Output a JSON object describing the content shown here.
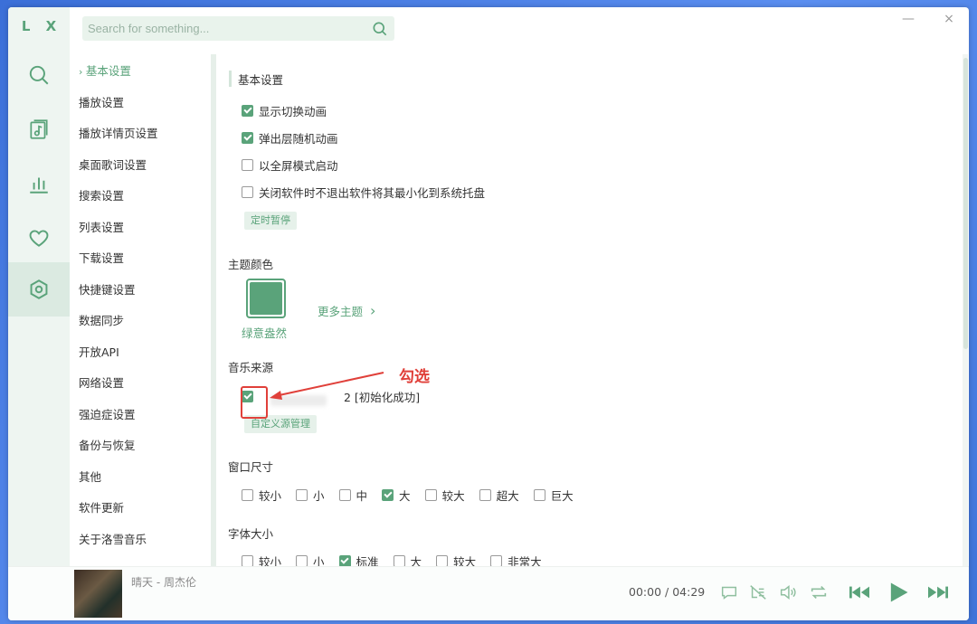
{
  "app": {
    "logo": "L X"
  },
  "search": {
    "placeholder": "Search for something..."
  },
  "window_controls": {
    "minimize": "—",
    "close": "×"
  },
  "rail": [
    {
      "name": "search-icon"
    },
    {
      "name": "music-list-icon"
    },
    {
      "name": "chart-icon"
    },
    {
      "name": "heart-icon"
    },
    {
      "name": "settings-icon",
      "active": true
    }
  ],
  "nav": {
    "items": [
      {
        "label": "基本设置",
        "active": true
      },
      {
        "label": "播放设置"
      },
      {
        "label": "播放详情页设置"
      },
      {
        "label": "桌面歌词设置"
      },
      {
        "label": "搜索设置"
      },
      {
        "label": "列表设置"
      },
      {
        "label": "下载设置"
      },
      {
        "label": "快捷键设置"
      },
      {
        "label": "数据同步"
      },
      {
        "label": "开放API"
      },
      {
        "label": "网络设置"
      },
      {
        "label": "强迫症设置"
      },
      {
        "label": "备份与恢复"
      },
      {
        "label": "其他"
      },
      {
        "label": "软件更新"
      },
      {
        "label": "关于洛雪音乐"
      }
    ]
  },
  "basic": {
    "title": "基本设置",
    "options": [
      {
        "label": "显示切换动画",
        "checked": true
      },
      {
        "label": "弹出层随机动画",
        "checked": true
      },
      {
        "label": "以全屏模式启动",
        "checked": false
      },
      {
        "label": "关闭软件时不退出软件将其最小化到系统托盘",
        "checked": false
      }
    ],
    "timer_button": "定时暂停"
  },
  "theme": {
    "title": "主题颜色",
    "current_name": "绿意盎然",
    "current_color": "#5aa37a",
    "more_label": "更多主题"
  },
  "source": {
    "title": "音乐来源",
    "item_suffix": "2 [初始化成功]",
    "checked": true,
    "manage_button": "自定义源管理",
    "annotation": "勾选"
  },
  "window_size": {
    "title": "窗口尺寸",
    "options": [
      {
        "label": "较小",
        "checked": false
      },
      {
        "label": "小",
        "checked": false
      },
      {
        "label": "中",
        "checked": false
      },
      {
        "label": "大",
        "checked": true
      },
      {
        "label": "较大",
        "checked": false
      },
      {
        "label": "超大",
        "checked": false
      },
      {
        "label": "巨大",
        "checked": false
      }
    ]
  },
  "font_size": {
    "title": "字体大小",
    "options": [
      {
        "label": "较小",
        "checked": false
      },
      {
        "label": "小",
        "checked": false
      },
      {
        "label": "标准",
        "checked": true
      },
      {
        "label": "大",
        "checked": false
      },
      {
        "label": "较大",
        "checked": false
      },
      {
        "label": "非常大",
        "checked": false
      }
    ]
  },
  "player": {
    "song": "晴天 - 周杰伦",
    "current": "00:00",
    "separator": "/",
    "duration": "04:29"
  },
  "colors": {
    "accent": "#5aa37a",
    "annotation": "#e0403a"
  }
}
